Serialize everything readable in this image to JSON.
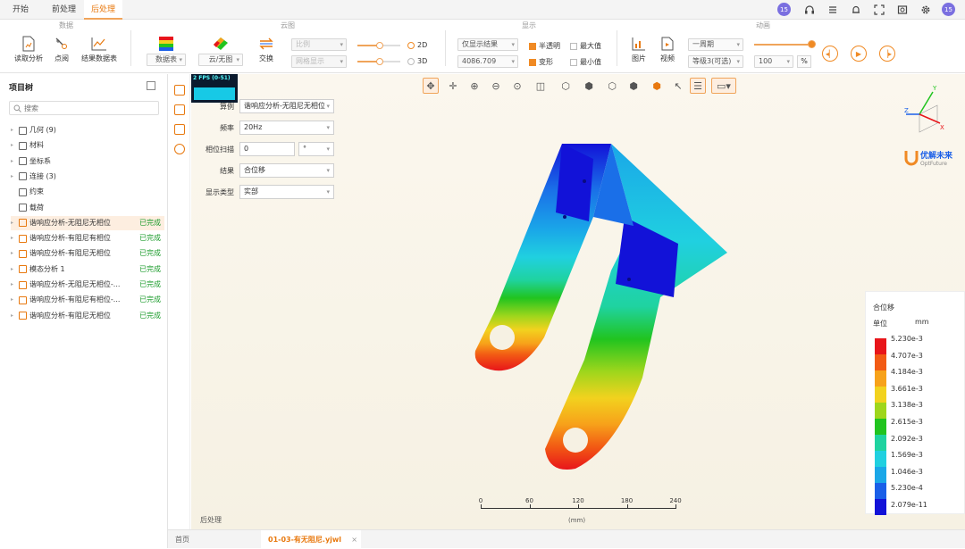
{
  "menu": {
    "tabs": [
      "开始",
      "前处理",
      "后处理"
    ],
    "active_index": 2,
    "user_badge": "15"
  },
  "ribbon": {
    "groups": [
      "数据",
      "云图",
      "动画",
      "显示",
      "动画"
    ],
    "data_buttons": [
      "读取分析",
      "点阅",
      "结果数据表"
    ],
    "cloud_buttons": [
      "数据表",
      "云/无图",
      "交换"
    ],
    "compare_select": "比例",
    "mesh_select": "网格显示",
    "radio_2d": "2D",
    "radio_3d": "3D",
    "result_select": "仅显示结果",
    "scale_value": "4086.709",
    "check_translucent": "半透明",
    "check_max": "最大值",
    "check_deform": "变形",
    "check_min": "最小值",
    "pic_buttons": [
      "图片",
      "视频"
    ],
    "cycle_select": "一周期",
    "grade_select": "等级3(可选)",
    "speed_value": "100",
    "speed_unit": "%"
  },
  "left_panel": {
    "title": "项目树",
    "search_placeholder": "搜索",
    "items": [
      {
        "label": "几何 (9)",
        "status": ""
      },
      {
        "label": "材料",
        "status": ""
      },
      {
        "label": "坐标系",
        "status": ""
      },
      {
        "label": "连接 (3)",
        "status": ""
      },
      {
        "label": "约束",
        "status": ""
      },
      {
        "label": "载荷",
        "status": ""
      },
      {
        "label": "谐响应分析-无阻尼无相位",
        "status": "已完成"
      },
      {
        "label": "谐响应分析-有阻尼有相位",
        "status": "已完成"
      },
      {
        "label": "谐响应分析-有阻尼无相位",
        "status": "已完成"
      },
      {
        "label": "模态分析 1",
        "status": "已完成"
      },
      {
        "label": "谐响应分析-无阻尼无相位-...",
        "status": "已完成"
      },
      {
        "label": "谐响应分析-有阻尼有相位-...",
        "status": "已完成"
      },
      {
        "label": "谐响应分析-有阻尼无相位",
        "status": "已完成"
      }
    ]
  },
  "viewport": {
    "fps": "2 FPS (0-51)",
    "form": {
      "case_label": "算例",
      "case_value": "谐响应分析-无阻尼无相位",
      "freq_label": "频率",
      "freq_value": "20Hz",
      "phase_label": "相位扫描",
      "phase_value": "0",
      "phase_unit": "°",
      "result_label": "结果",
      "result_value": "合位移",
      "display_label": "显示类型",
      "display_value": "实部"
    },
    "logo_main": "优解未来",
    "logo_sub": "OptFuture",
    "status_text": "后处理",
    "scale_ticks": [
      "0",
      "60",
      "120",
      "180",
      "240"
    ],
    "scale_unit": "(mm)"
  },
  "legend": {
    "title": "合位移",
    "unit_label": "单位",
    "unit_value": "mm",
    "values": [
      "5.230e-3",
      "4.707e-3",
      "4.184e-3",
      "3.661e-3",
      "3.138e-3",
      "2.615e-3",
      "2.092e-3",
      "1.569e-3",
      "1.046e-3",
      "5.230e-4",
      "2.079e-11"
    ],
    "colors": [
      "#e8151a",
      "#f25a14",
      "#f7a21a",
      "#f2d21e",
      "#9fd61c",
      "#21c41f",
      "#1fd3a0",
      "#20d0e0",
      "#1aa7e8",
      "#1a5fe8",
      "#1212d8"
    ]
  },
  "bottom_tabs": [
    "首页",
    "01-03-有无阻尼.yjwl"
  ],
  "bottom_active": 1
}
